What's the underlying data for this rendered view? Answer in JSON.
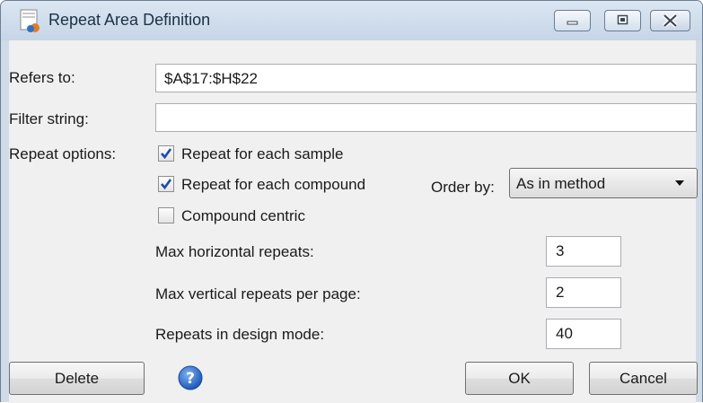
{
  "window": {
    "title": "Repeat Area Definition",
    "minimize_icon": "minimize-icon",
    "maximize_icon": "maximize-icon",
    "close_icon": "close-icon"
  },
  "form": {
    "refers_to_label": "Refers to:",
    "refers_to_value": "$A$17:$H$22",
    "filter_label": "Filter string:",
    "filter_value": "",
    "repeat_options_label": "Repeat options:",
    "options": [
      {
        "label": "Repeat for each sample",
        "checked": true
      },
      {
        "label": "Repeat for each compound",
        "checked": true
      },
      {
        "label": "Compound centric",
        "checked": false
      }
    ],
    "order_by_label": "Order by:",
    "order_by_value": "As in method",
    "max_horizontal_label": "Max horizontal repeats:",
    "max_horizontal_value": "3",
    "max_vertical_label": "Max vertical repeats per page:",
    "max_vertical_value": "2",
    "design_mode_label": "Repeats in design mode:",
    "design_mode_value": "40"
  },
  "buttons": {
    "delete": "Delete",
    "help_icon": "help-icon",
    "ok": "OK",
    "cancel": "Cancel"
  },
  "colors": {
    "titlebar": "#cfdbe8",
    "client": "#f0f0f0",
    "close_button_tint": "#c9d6e5",
    "help_blue": "#2f6fcf"
  }
}
